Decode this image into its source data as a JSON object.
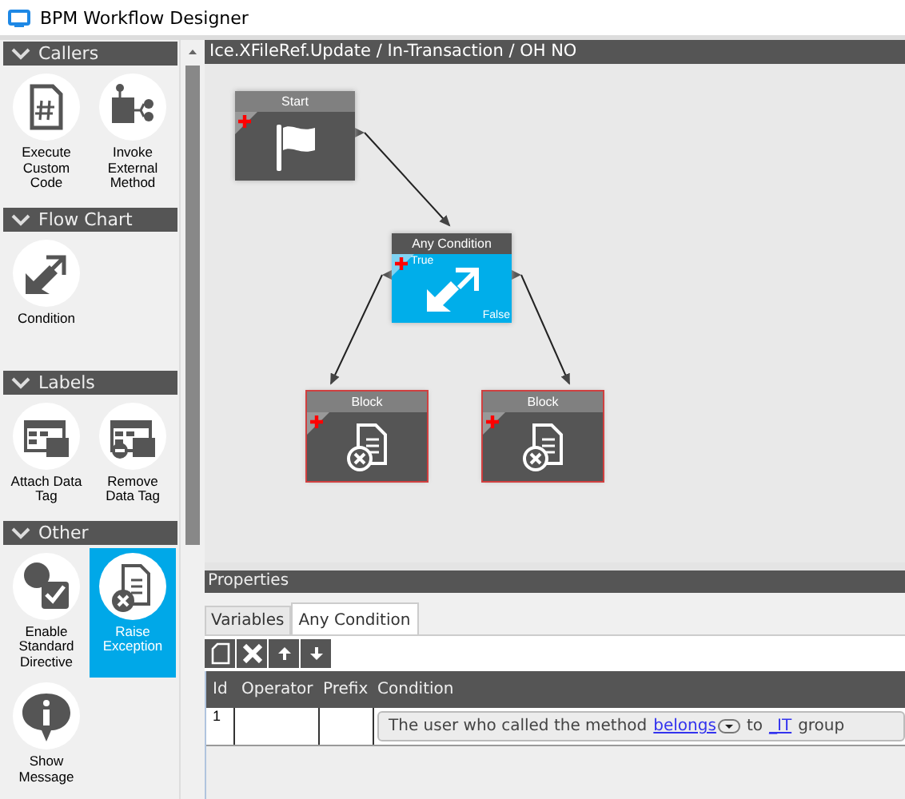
{
  "window": {
    "title": "BPM Workflow Designer"
  },
  "palette": {
    "sections": [
      {
        "title": "Callers",
        "items": [
          {
            "label": "Execute Custom Code",
            "selected": false
          },
          {
            "label": "Invoke External Method",
            "selected": false
          }
        ]
      },
      {
        "title": "Flow Chart",
        "items": [
          {
            "label": "Condition",
            "selected": false
          }
        ]
      },
      {
        "title": "Labels",
        "items": [
          {
            "label": "Attach Data Tag",
            "selected": false
          },
          {
            "label": "Remove Data Tag",
            "selected": false
          }
        ]
      },
      {
        "title": "Other",
        "items": [
          {
            "label": "Enable Standard Directive",
            "selected": false
          },
          {
            "label": "Raise Exception",
            "selected": true
          },
          {
            "label": "Show Message",
            "selected": false
          }
        ]
      }
    ]
  },
  "canvas": {
    "breadcrumb": "Ice.XFileRef.Update / In-Transaction / OH NO",
    "nodes": [
      {
        "kind": "start",
        "title": "Start",
        "invalid": false,
        "selected": false
      },
      {
        "kind": "condition",
        "title": "Any Condition",
        "true_label": "True",
        "false_label": "False",
        "invalid": false,
        "selected": true
      },
      {
        "kind": "block",
        "title": "Block",
        "invalid": true,
        "selected": false
      },
      {
        "kind": "block",
        "title": "Block",
        "invalid": true,
        "selected": false
      }
    ]
  },
  "properties": {
    "title": "Properties",
    "tabs": [
      {
        "label": "Variables",
        "selected": false
      },
      {
        "label": "Any Condition",
        "selected": true
      }
    ],
    "columns": [
      "Id",
      "Operator",
      "Prefix",
      "Condition"
    ],
    "rows": [
      {
        "id": "1",
        "condition": [
          {
            "kind": "text",
            "text": "The user who called the method"
          },
          {
            "kind": "link",
            "text": "belongs",
            "dropdown": true
          },
          {
            "kind": "text",
            "text": "to"
          },
          {
            "kind": "link",
            "text": "_IT",
            "dropdown": false
          },
          {
            "kind": "text",
            "text": "group"
          }
        ]
      }
    ]
  }
}
